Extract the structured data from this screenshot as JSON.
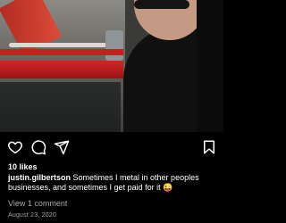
{
  "post": {
    "likes": "10 likes",
    "username": "justin.gilbertson",
    "caption": " Sometimes I metal in other peoples businesses, and sometimes I get paid for it 😜",
    "view_comments": "View 1 comment",
    "date": "August 23, 2020"
  },
  "icons": {
    "like": "heart-icon",
    "comment": "comment-icon",
    "share": "send-icon",
    "save": "bookmark-icon"
  },
  "colors": {
    "background": "#000000",
    "text": "#ffffff",
    "muted": "#a8a8a8"
  }
}
